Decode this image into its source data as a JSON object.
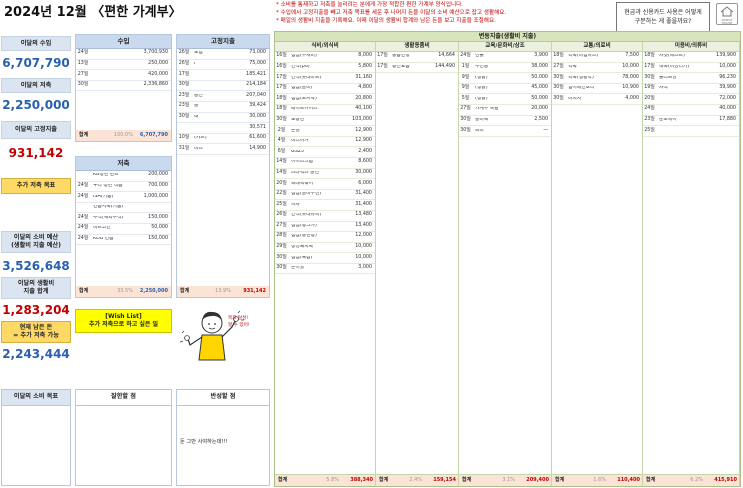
{
  "title": "2024년 12월 〈편한 가계부〉",
  "notes": [
    "* 소비를 통제하고 저축을 늘리려는 분에게 가장 적합한 편한 가계부 양식입니다.",
    "* 수입에서 고정지출을 빼고 저축 목표를 세운 후 나머지 돈을 이달의 소비 예산으로 잡고 생활해요.",
    "* 매일의 생활비 지출을 기록해요. 이때 이달의 생활비 합계와 남은 돈을 보고 지출을 조절해요."
  ],
  "help": {
    "line1": "현금과 신용카드 사용은 어떻게",
    "line2": "구분하는 게 좋을까요?"
  },
  "logo": {
    "text": "SIMPLE HOUSE"
  },
  "left": {
    "income_label": "이달의 수입",
    "income_value": "6,707,790",
    "saving_label": "이달의 저축",
    "saving_value": "2,250,000",
    "fixed_label": "이달의 고정지출",
    "fixed_value": "931,142",
    "extra_label": "추가 저축 목표",
    "budget_label1": "이달의 소비 예산",
    "budget_label2": "(생활비 지출 예산)",
    "budget_value": "3,526,648",
    "living_label1": "이달의 생활비",
    "living_label2": "지출 합계",
    "living_value": "1,283,204",
    "remain_label1": "현재 남은 돈",
    "remain_label2": "= 추가 저축 가능",
    "remain_value": "2,243,444",
    "goal_label": "이달의 소비 목표"
  },
  "income": {
    "head": "수입",
    "rows": [
      {
        "d": "24일",
        "n": "",
        "a": "3,700,930"
      },
      {
        "d": "13일",
        "n": "",
        "a": "250,000"
      },
      {
        "d": "27일",
        "n": "",
        "a": "420,000"
      },
      {
        "d": "30일",
        "n": "",
        "a": "2,336,860"
      }
    ],
    "sum": {
      "k": "합계",
      "p": "100.0%",
      "t": "6,707,790"
    }
  },
  "savings": {
    "head": "저축",
    "rows": [
      {
        "d": "",
        "n": "KB청년 펀드",
        "a": "200,000"
      },
      {
        "d": "24일",
        "n": "우리 청년 적금",
        "a": "700,000"
      },
      {
        "d": "24일",
        "n": "ISA(키움)",
        "a": "1,000,000"
      },
      {
        "d": "",
        "n": "연금저축(키움)",
        "a": ""
      },
      {
        "d": "24일",
        "n": "주식(해외주식)",
        "a": "150,000"
      },
      {
        "d": "24일",
        "n": "비트코인",
        "a": "50,000"
      },
      {
        "d": "24일",
        "n": "KDB 연금",
        "a": "150,000"
      }
    ],
    "sum": {
      "k": "합계",
      "p": "33.5%",
      "t": "2,250,000"
    }
  },
  "fixed": {
    "head": "고정지출",
    "rows": [
      {
        "d": "26일",
        "n": "보험",
        "a": "73,000"
      },
      {
        "d": "26일",
        "n": "F",
        "a": "75,000"
      },
      {
        "d": "17일",
        "n": "",
        "a": "185,421"
      },
      {
        "d": "30일",
        "n": "",
        "a": "214,184"
      },
      {
        "d": "23일",
        "n": "통신",
        "a": "207,040"
      },
      {
        "d": "23일",
        "n": "통",
        "a": "39,424"
      },
      {
        "d": "30일",
        "n": "대",
        "a": "30,000"
      },
      {
        "d": "",
        "n": "",
        "a": "30,571"
      },
      {
        "d": "10일",
        "n": "(카드)",
        "a": "61,600"
      },
      {
        "d": "31일",
        "n": "비스",
        "a": "14,900"
      }
    ],
    "sum": {
      "k": "합계",
      "p": "13.9%",
      "t": "931,142"
    }
  },
  "variable": {
    "head": "변동지출(생활비 지출)",
    "cols": [
      {
        "name": "식비/외식비",
        "rows": [
          {
            "d": "16일",
            "n": "점심(수제비)",
            "a": "8,000"
          },
          {
            "d": "16일",
            "n": "간식(pu)",
            "a": "5,800"
          },
          {
            "d": "17일",
            "n": "간식(롯데마트)",
            "a": "31,160"
          },
          {
            "d": "17일",
            "n": "점심(갈비)",
            "a": "4,800"
          },
          {
            "d": "18일",
            "n": "점심(도시락)",
            "a": "20,800"
          },
          {
            "d": "18일",
            "n": "페이트카이스",
            "a": "40,100"
          },
          {
            "d": "30일",
            "n": "노랑잔",
            "a": "103,000"
          },
          {
            "d": "2일",
            "n": "논길",
            "a": "12,900"
          },
          {
            "d": "4일",
            "n": "비디버거",
            "a": "12,900"
          },
          {
            "d": "6일",
            "n": "GS25",
            "a": "2,400"
          },
          {
            "d": "14일",
            "n": "어이스크림",
            "a": "8,600"
          },
          {
            "d": "14일",
            "n": "스타벅스 충전",
            "a": "30,000"
          },
          {
            "d": "20일",
            "n": "곡대떡볶이",
            "a": "6,000"
          },
          {
            "d": "22일",
            "n": "점심(갈비수산)",
            "a": "31,400"
          },
          {
            "d": "25일",
            "n": "피자",
            "a": "31,400"
          },
          {
            "d": "26일",
            "n": "간식(롯데슈퍼)",
            "a": "13,480"
          },
          {
            "d": "27일",
            "n": "점심(빵그가)",
            "a": "13,400"
          },
          {
            "d": "28일",
            "n": "점심(동천빵)",
            "a": "12,000"
          },
          {
            "d": "29일",
            "n": "정성돼지국",
            "a": "10,000"
          },
          {
            "d": "30일",
            "n": "점심(육짬)",
            "a": "10,000"
          },
          {
            "d": "30일",
            "n": "본이할",
            "a": "3,000"
          }
        ],
        "sum": {
          "p": "5.8%",
          "t": "388,340"
        }
      },
      {
        "name": "생활용품비",
        "rows": [
          {
            "d": "17일",
            "n": "중금면정",
            "a": "14,664"
          },
          {
            "d": "17일",
            "n": "동신요금",
            "a": "144,490"
          }
        ],
        "sum": {
          "p": "2.4%",
          "t": "159,154"
        }
      },
      {
        "name": "교육/문화비/상조",
        "rows": [
          {
            "d": "24일",
            "n": "선물",
            "a": "3,900"
          },
          {
            "d": "1일",
            "n": "무선통",
            "a": "38,000"
          },
          {
            "d": "9일",
            "n": "(생활)",
            "a": "50,000"
          },
          {
            "d": "9일",
            "n": "(생활)",
            "a": "45,000"
          },
          {
            "d": "5일",
            "n": "(생활)",
            "a": "50,000"
          },
          {
            "d": "27일",
            "n": "가계부 특별",
            "a": "20,000"
          },
          {
            "d": "30일",
            "n": "충비록",
            "a": "2,500"
          },
          {
            "d": "30일",
            "n": "회비",
            "a": "—"
          }
        ],
        "sum": {
          "p": "3.1%",
          "t": "209,400"
        }
      },
      {
        "name": "교통/의료비",
        "rows": [
          {
            "d": "18일",
            "n": "약국(비엠파스)",
            "a": "7,500"
          },
          {
            "d": "27일",
            "n": "약국",
            "a": "10,000"
          },
          {
            "d": "30일",
            "n": "약국(생활약)",
            "a": "78,000"
          },
          {
            "d": "30일",
            "n": "엠이메인호러",
            "a": "10,900"
          },
          {
            "d": "30일",
            "n": "바지지",
            "a": "4,000"
          }
        ],
        "sum": {
          "p": "1.6%",
          "t": "110,400"
        }
      },
      {
        "name": "미용비/의류비",
        "rows": [
          {
            "d": "18일",
            "n": "자켓(베스트)",
            "a": "139,900"
          },
          {
            "d": "17일",
            "n": "내복(미싱리기)",
            "a": "10,000"
          },
          {
            "d": "30일",
            "n": "올리브영",
            "a": "96,230"
          },
          {
            "d": "19일",
            "n": "자석",
            "a": "39,900"
          },
          {
            "d": "20일",
            "n": "",
            "a": "72,000"
          },
          {
            "d": "24일",
            "n": "",
            "a": "40,000"
          },
          {
            "d": "23일",
            "n": "준오헤어",
            "a": "17,880"
          },
          {
            "d": "25일",
            "n": "",
            "a": ""
          }
        ],
        "sum": {
          "p": "6.2%",
          "t": "415,910"
        }
      }
    ]
  },
  "wish": {
    "line1": "[Wish List]",
    "line2": "추가 저축으로 하고 싶은 일"
  },
  "bubble": {
    "line1": "목표 달성!",
    "line2": "할 수 있어!"
  },
  "reflect": {
    "good_head": "잘한할 점",
    "bad_head": "반성할 점",
    "bad_text": "돈 그만 사야하는데!!!"
  },
  "labels": {
    "sum": "합계"
  },
  "colors": {
    "blue": "#2a5fae",
    "red": "#c00000",
    "yellow": "#ffd966",
    "green_head": "#d8e4bc",
    "blue_head": "#c9d9ee"
  }
}
